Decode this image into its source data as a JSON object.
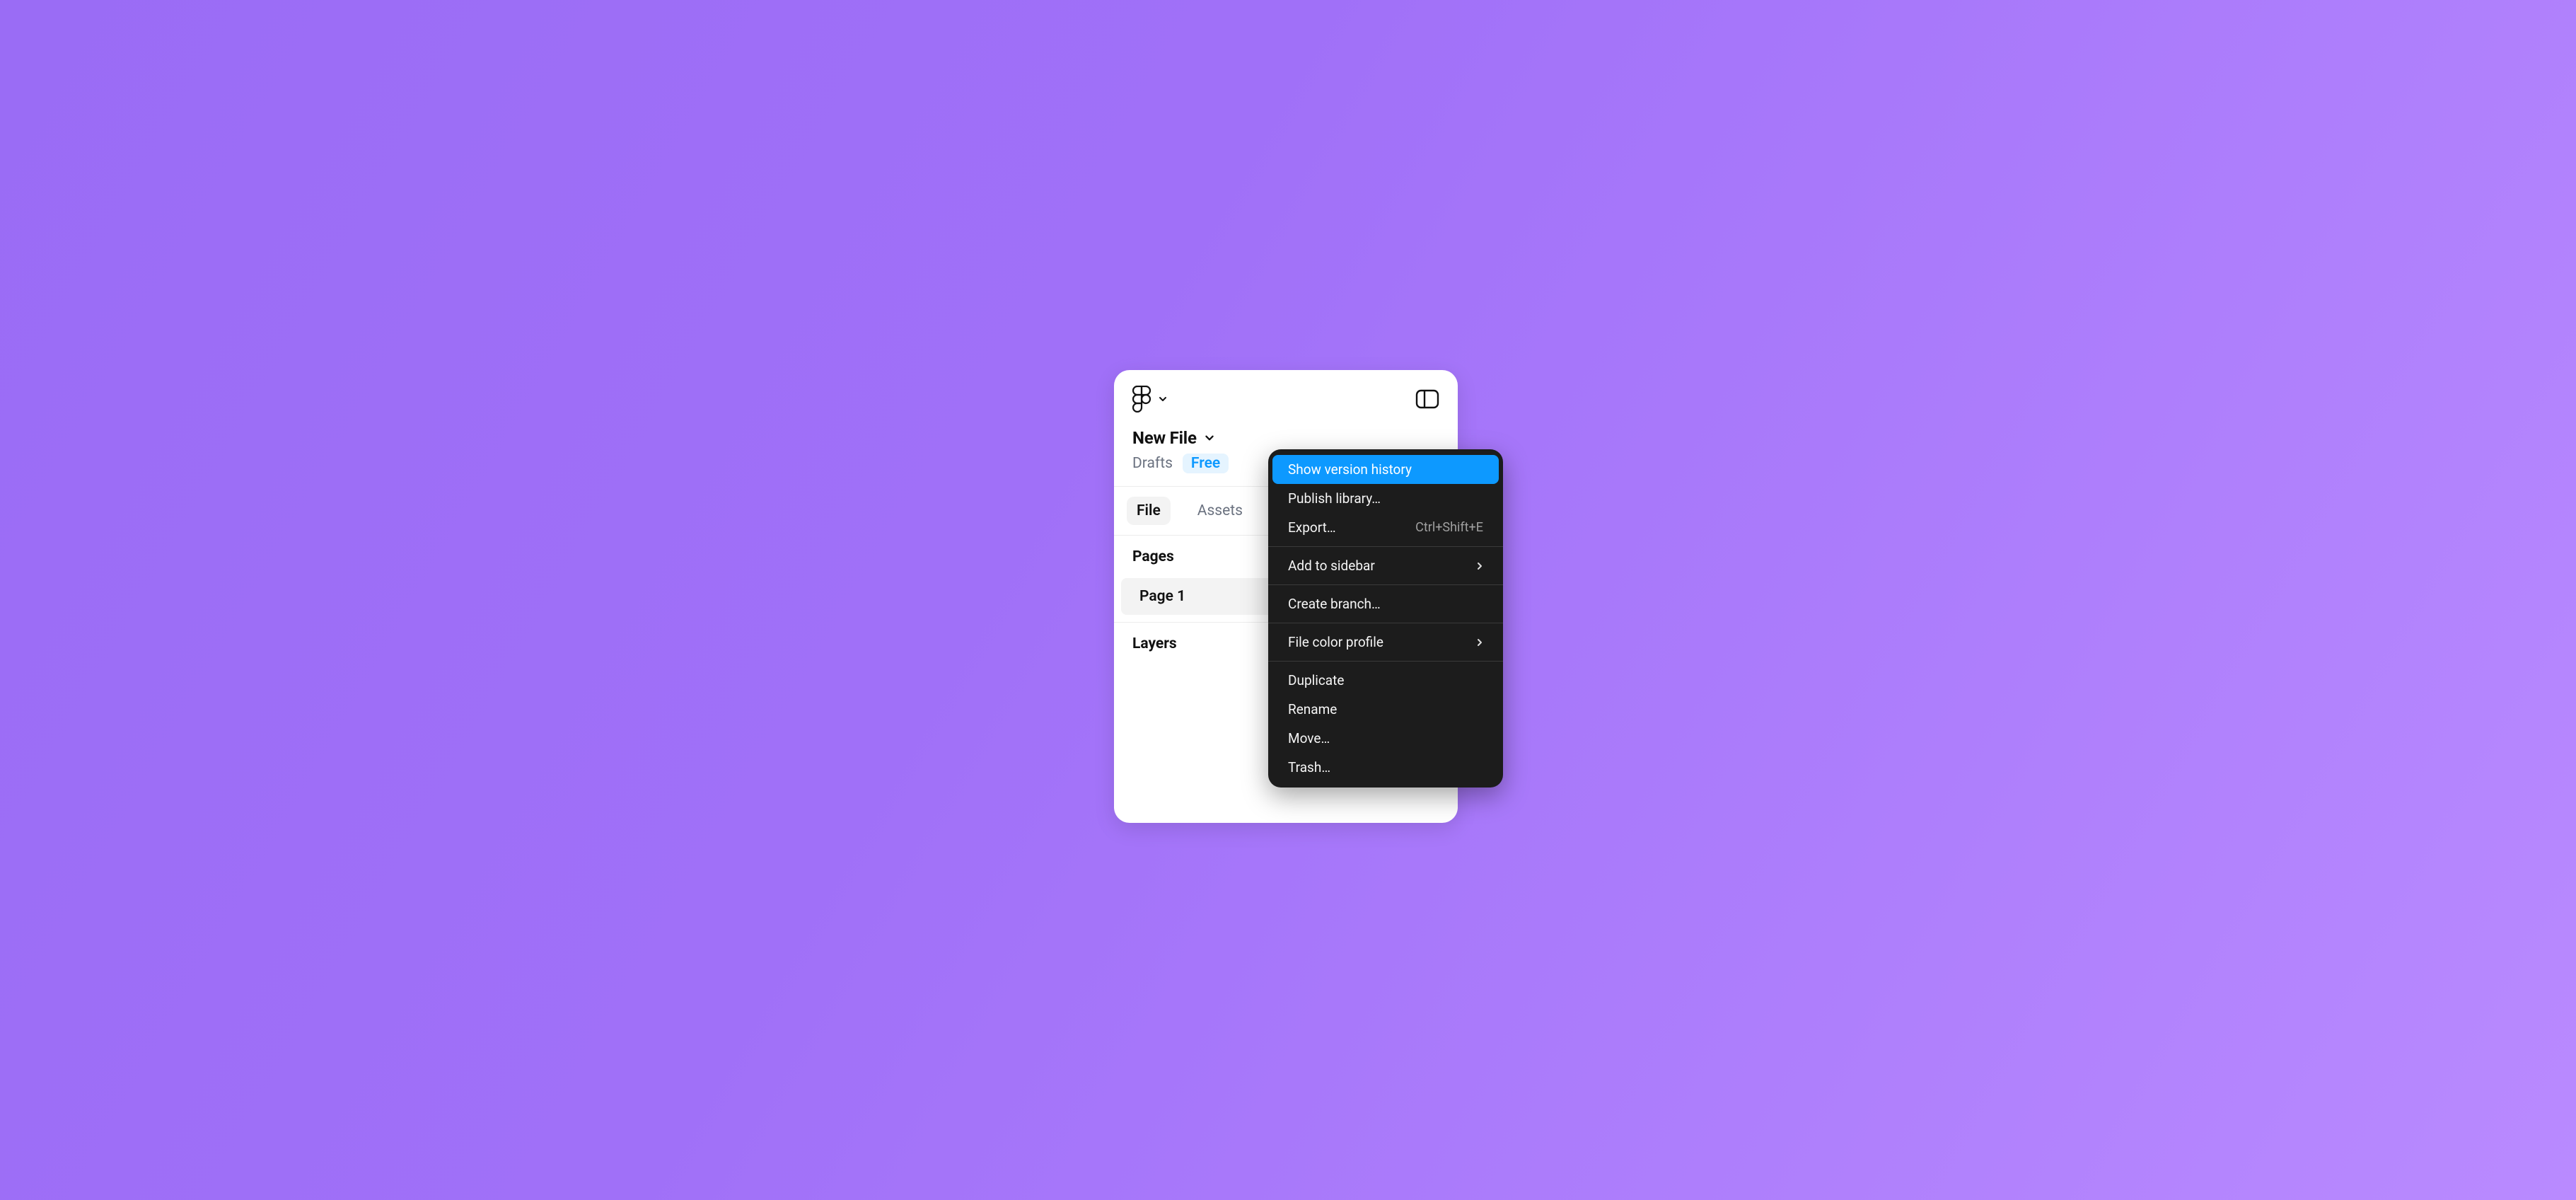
{
  "file": {
    "title": "New File",
    "location": "Drafts",
    "plan_badge": "Free"
  },
  "tabs": {
    "file": "File",
    "assets": "Assets"
  },
  "sections": {
    "pages": "Pages",
    "layers": "Layers"
  },
  "pages": {
    "item1": "Page 1"
  },
  "menu": {
    "show_version_history": "Show version history",
    "publish_library": "Publish library…",
    "export": "Export…",
    "export_shortcut": "Ctrl+Shift+E",
    "add_to_sidebar": "Add to sidebar",
    "create_branch": "Create branch…",
    "file_color_profile": "File color profile",
    "duplicate": "Duplicate",
    "rename": "Rename",
    "move": "Move…",
    "trash": "Trash…"
  }
}
